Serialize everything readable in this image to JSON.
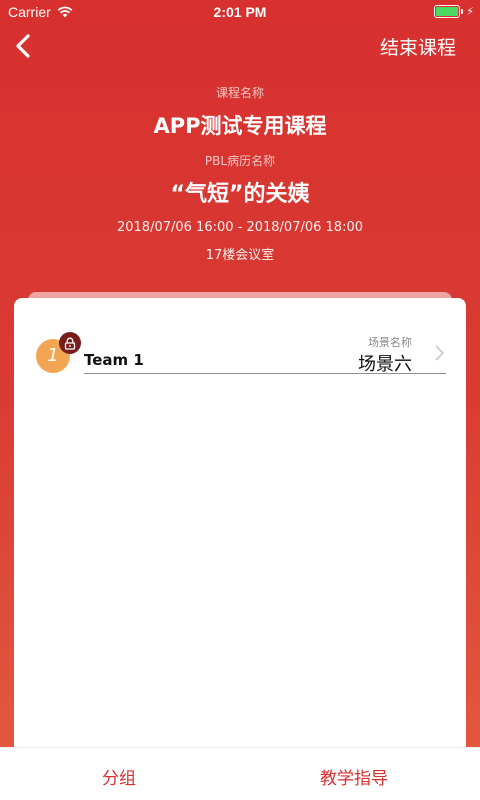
{
  "status_bar": {
    "carrier": "Carrier",
    "time": "2:01 PM",
    "battery_color": "#4cd964"
  },
  "nav": {
    "back_icon": "chevron-left-icon",
    "end_course": "结束课程"
  },
  "course": {
    "name_label": "课程名称",
    "name": "APP测试专用课程",
    "pbl_label": "PBL病历名称",
    "pbl_name": "“气短”的关姨",
    "time_range": "2018/07/06 16:00 - 2018/07/06 18:00",
    "location": "17楼会议室"
  },
  "teams": [
    {
      "number": "1",
      "lock_icon": "lock-icon",
      "name": "Team 1",
      "scene_label": "场景名称",
      "scene_name": "场景六"
    }
  ],
  "tabbar": {
    "group": "分组",
    "guide": "教学指导"
  },
  "colors": {
    "primary": "#d7302f",
    "badge": "#f2a654",
    "lock_badge": "#7a1b1c"
  }
}
